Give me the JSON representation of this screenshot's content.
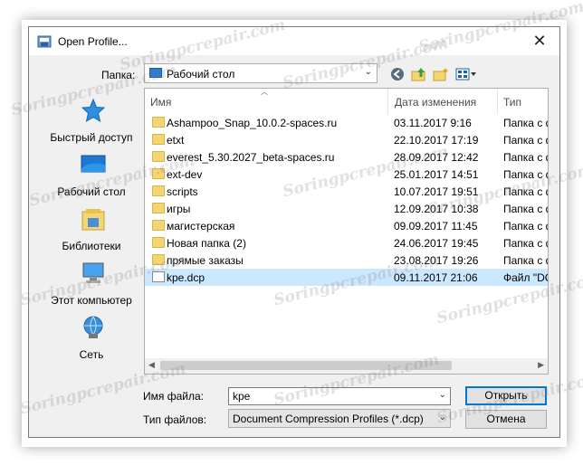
{
  "window": {
    "title": "Open Profile...",
    "close": "✕"
  },
  "toolbar": {
    "lookin_label": "Папка:",
    "lookin_value": "Рабочий стол"
  },
  "places": [
    {
      "label": "Быстрый доступ",
      "icon": "star-icon"
    },
    {
      "label": "Рабочий стол",
      "icon": "desktop-icon"
    },
    {
      "label": "Библиотеки",
      "icon": "libraries-icon"
    },
    {
      "label": "Этот компьютер",
      "icon": "computer-icon"
    },
    {
      "label": "Сеть",
      "icon": "network-icon"
    }
  ],
  "columns": {
    "name": "Имя",
    "date": "Дата изменения",
    "type": "Тип"
  },
  "files": [
    {
      "name": "Ashampoo_Snap_10.0.2-spaces.ru",
      "date": "03.11.2017 9:16",
      "type": "Папка с ф"
    },
    {
      "name": "etxt",
      "date": "22.10.2017 17:19",
      "type": "Папка с ф"
    },
    {
      "name": "everest_5.30.2027_beta-spaces.ru",
      "date": "28.09.2017 12:42",
      "type": "Папка с ф"
    },
    {
      "name": "ext-dev",
      "date": "25.01.2017 14:51",
      "type": "Папка с ф"
    },
    {
      "name": "scripts",
      "date": "10.07.2017 19:51",
      "type": "Папка с ф"
    },
    {
      "name": "игры",
      "date": "12.09.2017 10:38",
      "type": "Папка с ф"
    },
    {
      "name": "магистерская",
      "date": "09.09.2017 11:45",
      "type": "Папка с ф"
    },
    {
      "name": "Новая папка (2)",
      "date": "24.06.2017 19:45",
      "type": "Папка с ф"
    },
    {
      "name": "прямые заказы",
      "date": "23.08.2017 19:26",
      "type": "Папка с ф"
    },
    {
      "name": "kpe.dcp",
      "date": "09.11.2017 21:06",
      "type": "Файл \"DC"
    }
  ],
  "filename": {
    "label": "Имя файла:",
    "value": "kpe"
  },
  "filetype": {
    "label": "Тип файлов:",
    "value": "Document Compression Profiles (*.dcp)"
  },
  "buttons": {
    "open": "Открыть",
    "cancel": "Отмена"
  },
  "watermark": "Soringpcrepair.com"
}
